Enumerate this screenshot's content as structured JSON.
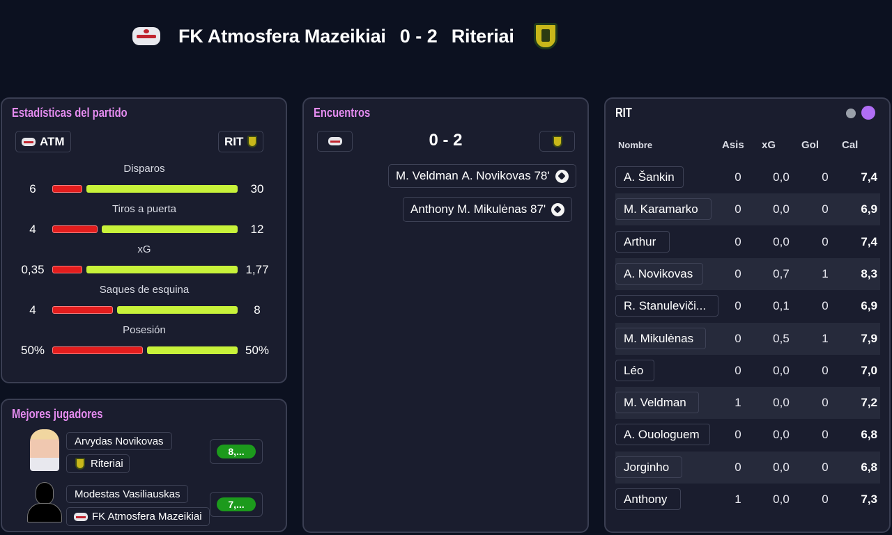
{
  "match": {
    "home_team": "FK Atmosfera Mazeikiai",
    "score": "0 - 2",
    "away_team": "Riteriai"
  },
  "stats_panel": {
    "title": "Estadísticas del partido",
    "home_abbr": "ATM",
    "away_abbr": "RIT",
    "stats": [
      {
        "label": "Disparos",
        "home": "6",
        "away": "30",
        "home_share": 0.167
      },
      {
        "label": "Tiros a puerta",
        "home": "4",
        "away": "12",
        "home_share": 0.25
      },
      {
        "label": "xG",
        "home": "0,35",
        "away": "1,77",
        "home_share": 0.165
      },
      {
        "label": "Saques de esquina",
        "home": "4",
        "away": "8",
        "home_share": 0.333
      },
      {
        "label": "Posesión",
        "home": "50%",
        "away": "50%",
        "home_share": 0.5
      }
    ]
  },
  "best_players": {
    "title": "Mejores jugadores",
    "players": [
      {
        "name": "Arvydas Novikovas",
        "team": "Riteriai",
        "rating": "8,..."
      },
      {
        "name": "Modestas Vasiliauskas",
        "team": "FK Atmosfera Mazeikiai",
        "rating": "7,..."
      }
    ]
  },
  "encounters": {
    "title": "Encuentros",
    "score": "0 - 2",
    "events": [
      {
        "assist": "M. Veldman",
        "scorer": "A. Novikovas",
        "minute": "78'"
      },
      {
        "assist": "Anthony",
        "scorer": "M. Mikulėnas",
        "minute": "87'"
      }
    ]
  },
  "players_table": {
    "team": "RIT",
    "headers": {
      "name": "Nombre",
      "assists": "Asis",
      "xg": "xG",
      "goals": "Gol",
      "rating": "Cal"
    },
    "rows": [
      {
        "name": "A. Šankin",
        "assists": "0",
        "xg": "0,0",
        "goals": "0",
        "rating": "7,4"
      },
      {
        "name": "M. Karamarko",
        "assists": "0",
        "xg": "0,0",
        "goals": "0",
        "rating": "6,9"
      },
      {
        "name": "Arthur",
        "assists": "0",
        "xg": "0,0",
        "goals": "0",
        "rating": "7,4"
      },
      {
        "name": "A. Novikovas",
        "assists": "0",
        "xg": "0,7",
        "goals": "1",
        "rating": "8,3"
      },
      {
        "name": "R. Stanuleviči...",
        "assists": "0",
        "xg": "0,1",
        "goals": "0",
        "rating": "6,9"
      },
      {
        "name": "M. Mikulėnas",
        "assists": "0",
        "xg": "0,5",
        "goals": "1",
        "rating": "7,9"
      },
      {
        "name": "Léo",
        "assists": "0",
        "xg": "0,0",
        "goals": "0",
        "rating": "7,0"
      },
      {
        "name": "M. Veldman",
        "assists": "1",
        "xg": "0,0",
        "goals": "0",
        "rating": "7,2"
      },
      {
        "name": "A. Ouologuem",
        "assists": "0",
        "xg": "0,0",
        "goals": "0",
        "rating": "6,8"
      },
      {
        "name": "Jorginho",
        "assists": "0",
        "xg": "0,0",
        "goals": "0",
        "rating": "6,8"
      },
      {
        "name": "Anthony",
        "assists": "1",
        "xg": "0,0",
        "goals": "0",
        "rating": "7,3"
      }
    ]
  },
  "colors": {
    "accent_title": "#e58cf0",
    "home_bar": "#e31d1d",
    "away_bar": "#c8f23a",
    "rating_pill": "#1c9a1c",
    "toggle_active": "#b06ef5"
  }
}
